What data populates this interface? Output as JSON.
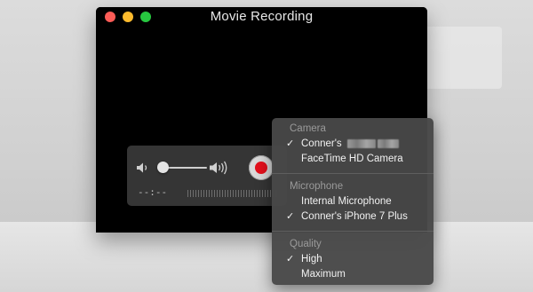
{
  "window": {
    "title": "Movie Recording"
  },
  "controls": {
    "time_display": "--:--",
    "volume_level": 0.0
  },
  "menu": {
    "camera": {
      "heading": "Camera",
      "items": [
        {
          "label": "Conner's",
          "checked": true,
          "redacted": true
        },
        {
          "label": "FaceTime HD Camera",
          "checked": false
        }
      ]
    },
    "microphone": {
      "heading": "Microphone",
      "items": [
        {
          "label": "Internal Microphone",
          "checked": false
        },
        {
          "label": "Conner's iPhone 7 Plus",
          "checked": true
        }
      ]
    },
    "quality": {
      "heading": "Quality",
      "items": [
        {
          "label": "High",
          "checked": true
        },
        {
          "label": "Maximum",
          "checked": false
        }
      ]
    },
    "check_glyph": "✓"
  },
  "colors": {
    "record_red": "#e4101c",
    "close": "#fc5c57",
    "minimize": "#fdbb2d",
    "maximize": "#27c840"
  },
  "icons": [
    "volume-low-icon",
    "volume-high-icon",
    "record-icon",
    "checkmark-icon"
  ]
}
